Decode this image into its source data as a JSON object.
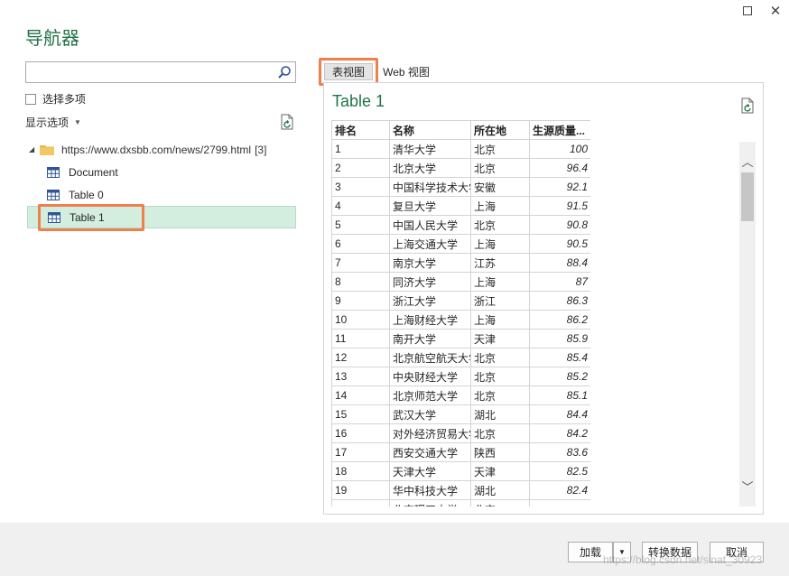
{
  "window": {
    "title": "导航器"
  },
  "search": {
    "value": "",
    "placeholder": ""
  },
  "left": {
    "multi_select_label": "选择多项",
    "display_options_label": "显示选项",
    "tree": {
      "root_label": "https://www.dxsbb.com/news/2799.html",
      "root_count": "[3]",
      "items": [
        {
          "label": "Document",
          "icon": "table-icon"
        },
        {
          "label": "Table 0",
          "icon": "table-icon"
        },
        {
          "label": "Table 1",
          "icon": "table-icon",
          "selected": true
        }
      ]
    }
  },
  "tabs": [
    {
      "label": "表视图",
      "active": true
    },
    {
      "label": "Web 视图",
      "active": false
    }
  ],
  "preview": {
    "title": "Table 1",
    "columns": [
      "排名",
      "名称",
      "所在地",
      "生源质量..."
    ],
    "rows": [
      [
        "1",
        "清华大学",
        "北京",
        "100"
      ],
      [
        "2",
        "北京大学",
        "北京",
        "96.4"
      ],
      [
        "3",
        "中国科学技术大学",
        "安徽",
        "92.1"
      ],
      [
        "4",
        "复旦大学",
        "上海",
        "91.5"
      ],
      [
        "5",
        "中国人民大学",
        "北京",
        "90.8"
      ],
      [
        "6",
        "上海交通大学",
        "上海",
        "90.5"
      ],
      [
        "7",
        "南京大学",
        "江苏",
        "88.4"
      ],
      [
        "8",
        "同济大学",
        "上海",
        "87"
      ],
      [
        "9",
        "浙江大学",
        "浙江",
        "86.3"
      ],
      [
        "10",
        "上海财经大学",
        "上海",
        "86.2"
      ],
      [
        "11",
        "南开大学",
        "天津",
        "85.9"
      ],
      [
        "12",
        "北京航空航天大学",
        "北京",
        "85.4"
      ],
      [
        "13",
        "中央财经大学",
        "北京",
        "85.2"
      ],
      [
        "14",
        "北京师范大学",
        "北京",
        "85.1"
      ],
      [
        "15",
        "武汉大学",
        "湖北",
        "84.4"
      ],
      [
        "16",
        "对外经济贸易大学",
        "北京",
        "84.2"
      ],
      [
        "17",
        "西安交通大学",
        "陕西",
        "83.6"
      ],
      [
        "18",
        "天津大学",
        "天津",
        "82.5"
      ],
      [
        "19",
        "华中科技大学",
        "湖北",
        "82.4"
      ],
      [
        "",
        "北京理工大学",
        "北京",
        ""
      ]
    ]
  },
  "footer": {
    "load_label": "加载",
    "transform_label": "转换数据",
    "cancel_label": "取消",
    "watermark": "https://blog.csdn.net/sinat_30923"
  },
  "colors": {
    "accent": "#217346",
    "highlight": "#ef7f4b",
    "selected_bg": "#d3eddf"
  }
}
